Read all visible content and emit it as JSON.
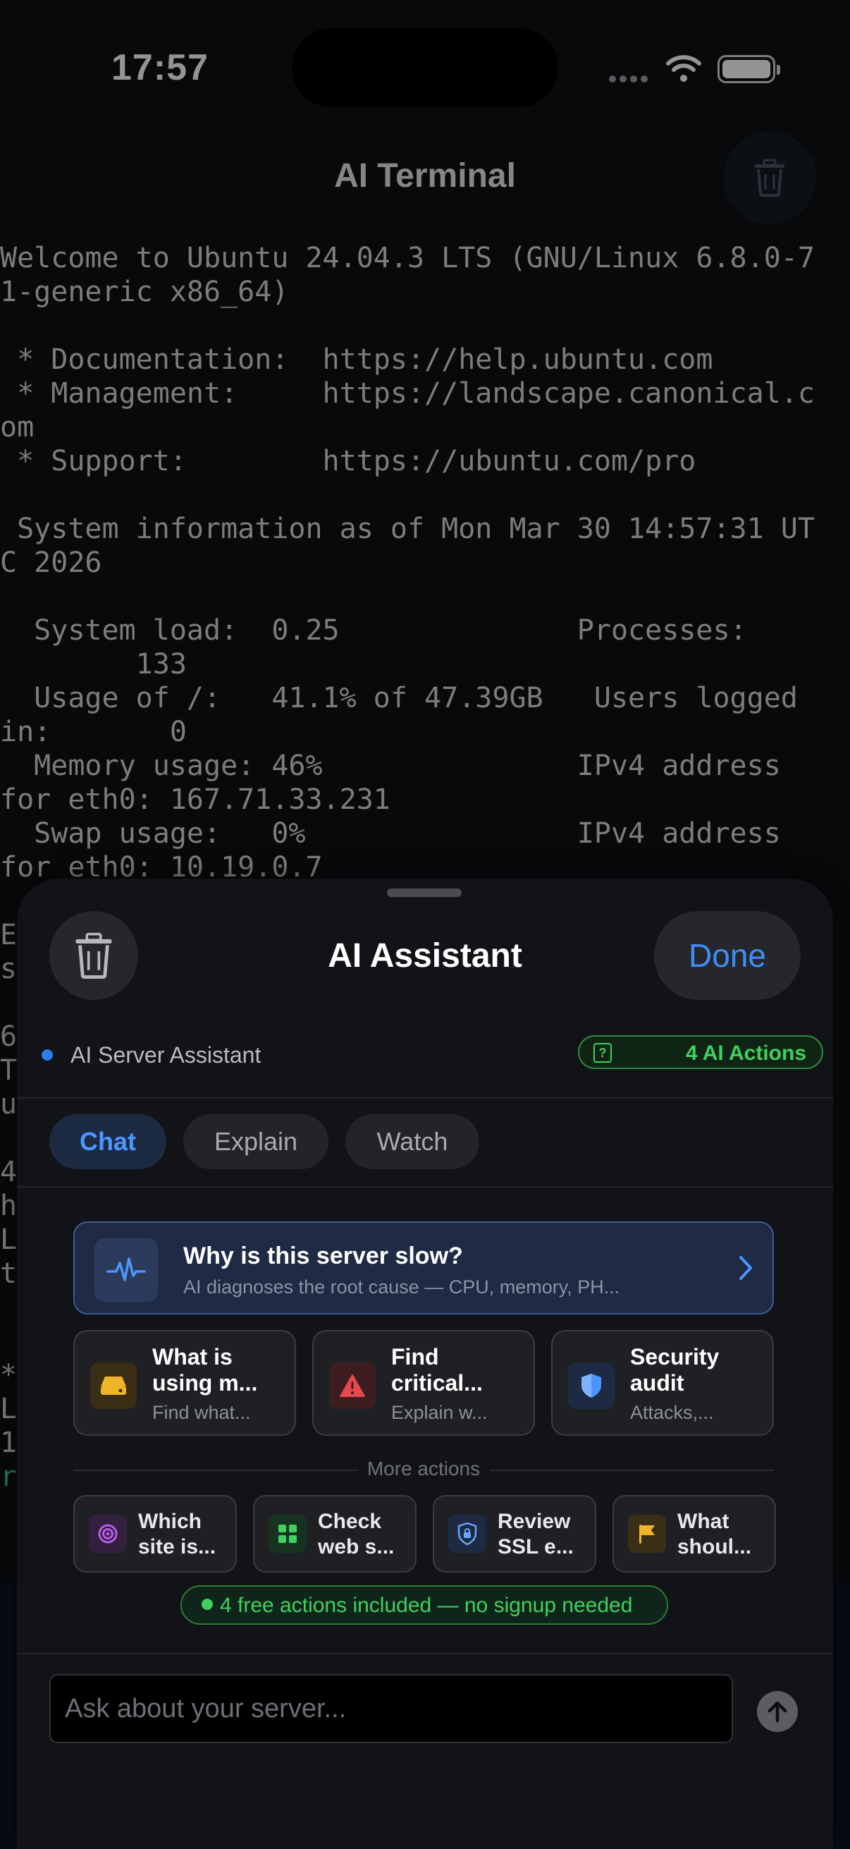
{
  "status_bar": {
    "time": "17:57"
  },
  "terminal": {
    "title": "AI Terminal",
    "lines": [
      "Welcome to Ubuntu 24.04.3 LTS (GNU/Linux 6.8.0-7",
      "1-generic x86_64)",
      "",
      " * Documentation:  https://help.ubuntu.com",
      " * Management:     https://landscape.canonical.c",
      "om",
      " * Support:        https://ubuntu.com/pro",
      "",
      " System information as of Mon Mar 30 14:57:31 UT",
      "C 2026",
      "",
      "  System load:  0.25              Processes:",
      "        133",
      "  Usage of /:   41.1% of 47.39GB   Users logged",
      "in:       0",
      "  Memory usage: 46%               IPv4 address",
      "for eth0: 167.71.33.231",
      "  Swap usage:   0%                IPv4 address",
      "for eth0: 10.19.0.7",
      "",
      "E                                              i",
      "s",
      "",
      "6",
      "T                                              _",
      "u",
      "",
      "4                                              t",
      "h",
      "L                                              t",
      "t",
      "",
      "",
      "*",
      "L                                              .",
      "1"
    ],
    "prompt_fragment": "r"
  },
  "sheet": {
    "title": "AI Assistant",
    "done_label": "Done",
    "assistant_label": "AI Server Assistant",
    "actions_badge": "4 AI Actions",
    "tabs": [
      "Chat",
      "Explain",
      "Watch"
    ],
    "featured": {
      "title": "Why is this server slow?",
      "subtitle": "AI diagnoses the root cause — CPU, memory, PH..."
    },
    "cards": [
      {
        "title": "What is\nusing m...",
        "subtitle": "Find what..."
      },
      {
        "title": "Find\ncritical...",
        "subtitle": "Explain w..."
      },
      {
        "title": "Security\naudit",
        "subtitle": "Attacks,..."
      }
    ],
    "more_label": "More actions",
    "mini_actions": [
      {
        "title": "Which\nsite is..."
      },
      {
        "title": "Check\nweb s..."
      },
      {
        "title": "Review\nSSL e..."
      },
      {
        "title": "What\nshoul..."
      }
    ],
    "free_note": "4 free actions included — no signup needed",
    "input_placeholder": "Ask about your server..."
  },
  "colors": {
    "accent_blue": "#3f8ef5",
    "accent_green": "#3ed15f",
    "warning_yellow": "#f0b429",
    "danger_red": "#e5484d",
    "purple": "#b55fe8"
  }
}
